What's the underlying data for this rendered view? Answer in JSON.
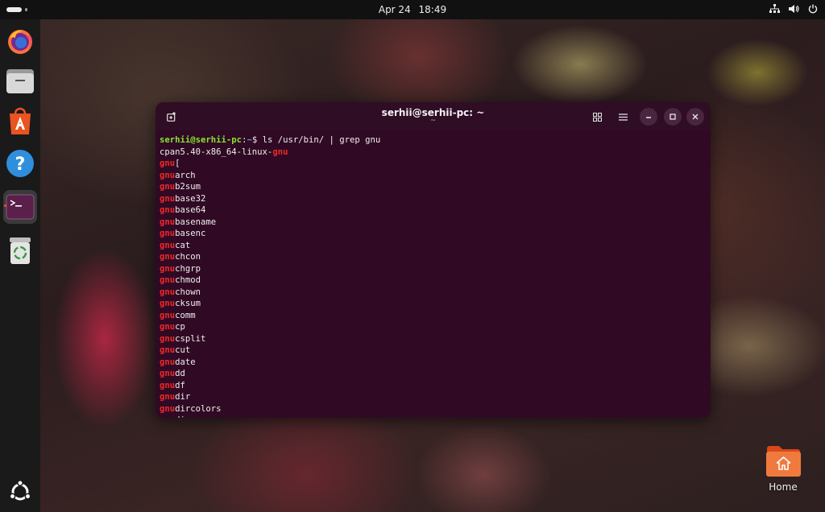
{
  "topbar": {
    "date": "Apr 24",
    "time": "18:49",
    "tray_icons": [
      "network-icon",
      "volume-icon",
      "power-icon"
    ]
  },
  "dock": {
    "items": [
      {
        "name": "firefox",
        "icon": "firefox-icon"
      },
      {
        "name": "files",
        "icon": "files-icon"
      },
      {
        "name": "app-center",
        "icon": "app-center-icon"
      },
      {
        "name": "help",
        "icon": "help-icon"
      },
      {
        "name": "terminal",
        "icon": "terminal-icon",
        "active": true
      },
      {
        "name": "trash",
        "icon": "trash-icon"
      }
    ],
    "show_apps": "ubuntu-logo-icon"
  },
  "terminal": {
    "title": "serhii@serhii-pc: ~",
    "subtitle": "~",
    "prompt_user": "serhii@serhii-pc",
    "prompt_colon": ":",
    "prompt_path": "~",
    "prompt_symbol": "$ ",
    "command": "ls /usr/bin/ | grep gnu",
    "output": [
      {
        "pre": "cpan5.40-x86_64-linux-",
        "match": "gnu",
        "post": ""
      },
      {
        "pre": "",
        "match": "gnu",
        "post": "["
      },
      {
        "pre": "",
        "match": "gnu",
        "post": "arch"
      },
      {
        "pre": "",
        "match": "gnu",
        "post": "b2sum"
      },
      {
        "pre": "",
        "match": "gnu",
        "post": "base32"
      },
      {
        "pre": "",
        "match": "gnu",
        "post": "base64"
      },
      {
        "pre": "",
        "match": "gnu",
        "post": "basename"
      },
      {
        "pre": "",
        "match": "gnu",
        "post": "basenc"
      },
      {
        "pre": "",
        "match": "gnu",
        "post": "cat"
      },
      {
        "pre": "",
        "match": "gnu",
        "post": "chcon"
      },
      {
        "pre": "",
        "match": "gnu",
        "post": "chgrp"
      },
      {
        "pre": "",
        "match": "gnu",
        "post": "chmod"
      },
      {
        "pre": "",
        "match": "gnu",
        "post": "chown"
      },
      {
        "pre": "",
        "match": "gnu",
        "post": "cksum"
      },
      {
        "pre": "",
        "match": "gnu",
        "post": "comm"
      },
      {
        "pre": "",
        "match": "gnu",
        "post": "cp"
      },
      {
        "pre": "",
        "match": "gnu",
        "post": "csplit"
      },
      {
        "pre": "",
        "match": "gnu",
        "post": "cut"
      },
      {
        "pre": "",
        "match": "gnu",
        "post": "date"
      },
      {
        "pre": "",
        "match": "gnu",
        "post": "dd"
      },
      {
        "pre": "",
        "match": "gnu",
        "post": "df"
      },
      {
        "pre": "",
        "match": "gnu",
        "post": "dir"
      },
      {
        "pre": "",
        "match": "gnu",
        "post": "dircolors"
      },
      {
        "pre": "",
        "match": "gnu",
        "post": "dirname"
      }
    ]
  },
  "desktop": {
    "home_label": "Home"
  },
  "colors": {
    "terminal_bg": "#300a24",
    "prompt_user": "#8ae234",
    "prompt_path": "#729fcf",
    "match": "#ef2929",
    "accent": "#e95420"
  }
}
